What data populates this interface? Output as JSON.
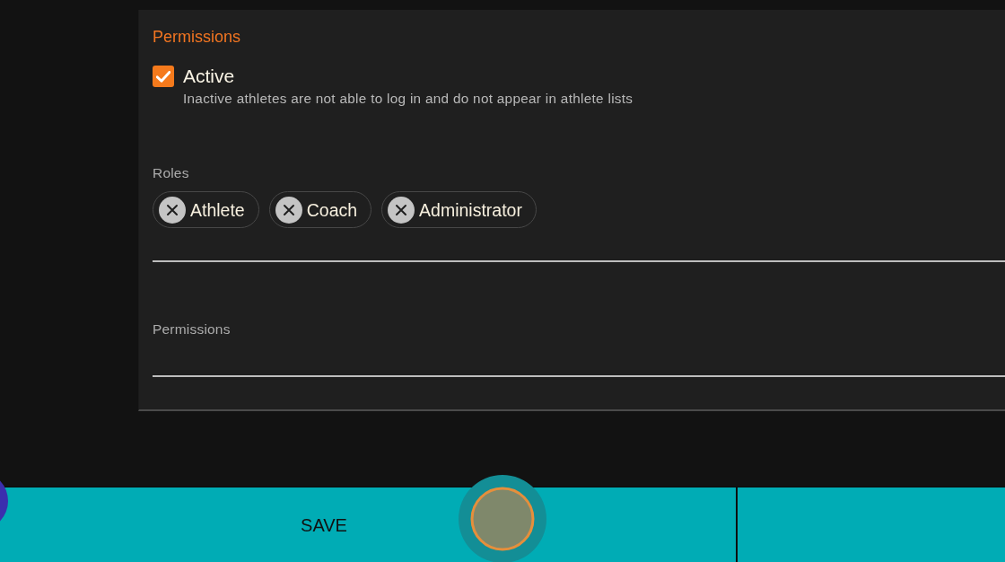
{
  "section_title": "Permissions",
  "active_checkbox": {
    "label": "Active",
    "checked": true,
    "helper": "Inactive athletes are not able to log in and do not appear in athlete lists"
  },
  "roles_field": {
    "label": "Roles",
    "chips": [
      {
        "label": "Athlete"
      },
      {
        "label": "Coach"
      },
      {
        "label": "Administrator"
      }
    ]
  },
  "permissions_field": {
    "label": "Permissions"
  },
  "bottom_bar": {
    "save_button": "SAVE"
  }
}
